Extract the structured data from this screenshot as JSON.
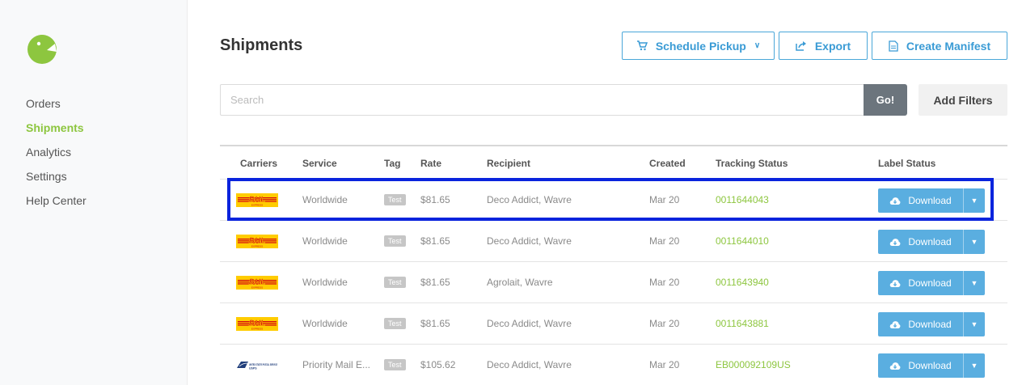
{
  "sidebar": {
    "logo_icon": "beaver-logo-icon",
    "items": [
      {
        "label": "Orders",
        "active": false
      },
      {
        "label": "Shipments",
        "active": true
      },
      {
        "label": "Analytics",
        "active": false
      },
      {
        "label": "Settings",
        "active": false
      },
      {
        "label": "Help Center",
        "active": false
      }
    ]
  },
  "header": {
    "title": "Shipments",
    "schedule_pickup": "Schedule Pickup",
    "export": "Export",
    "create_manifest": "Create Manifest"
  },
  "search": {
    "placeholder": "Search",
    "value": "",
    "go": "Go!",
    "add_filters": "Add Filters"
  },
  "table": {
    "columns": [
      "Carriers",
      "Service",
      "Tag",
      "Rate",
      "Recipient",
      "Created",
      "Tracking Status",
      "Label Status"
    ],
    "rows": [
      {
        "carrier": "DHL",
        "carrier_subtext": "EXPRESS",
        "service": "Worldwide",
        "tag": "Test",
        "rate": "$81.65",
        "recipient": "Deco Addict, Wavre",
        "created": "Mar 20",
        "tracking": "0011644043",
        "label": "Download"
      },
      {
        "carrier": "DHL",
        "carrier_subtext": "EXPRESS",
        "service": "Worldwide",
        "tag": "Test",
        "rate": "$81.65",
        "recipient": "Deco Addict, Wavre",
        "created": "Mar 20",
        "tracking": "0011644010",
        "label": "Download"
      },
      {
        "carrier": "DHL",
        "carrier_subtext": "EXPRESS",
        "service": "Worldwide",
        "tag": "Test",
        "rate": "$81.65",
        "recipient": "Agrolait, Wavre",
        "created": "Mar 20",
        "tracking": "0011643940",
        "label": "Download"
      },
      {
        "carrier": "DHL",
        "carrier_subtext": "EXPRESS",
        "service": "Worldwide",
        "tag": "Test",
        "rate": "$81.65",
        "recipient": "Deco Addict, Wavre",
        "created": "Mar 20",
        "tracking": "0011643881",
        "label": "Download"
      },
      {
        "carrier": "USPS",
        "carrier_subtext": "UNITED STATES POSTAL SERVICE",
        "service": "Priority Mail E...",
        "tag": "Test",
        "rate": "$105.62",
        "recipient": "Deco Addict, Wavre",
        "created": "Mar 20",
        "tracking": "EB000092109US",
        "label": "Download"
      }
    ]
  },
  "colors": {
    "accent_green": "#8dc63f",
    "accent_blue": "#3a9bd5",
    "download_blue": "#5aaee0",
    "highlight": "#0a24dd",
    "dhl_yellow": "#ffcc00",
    "dhl_red": "#d40511"
  }
}
